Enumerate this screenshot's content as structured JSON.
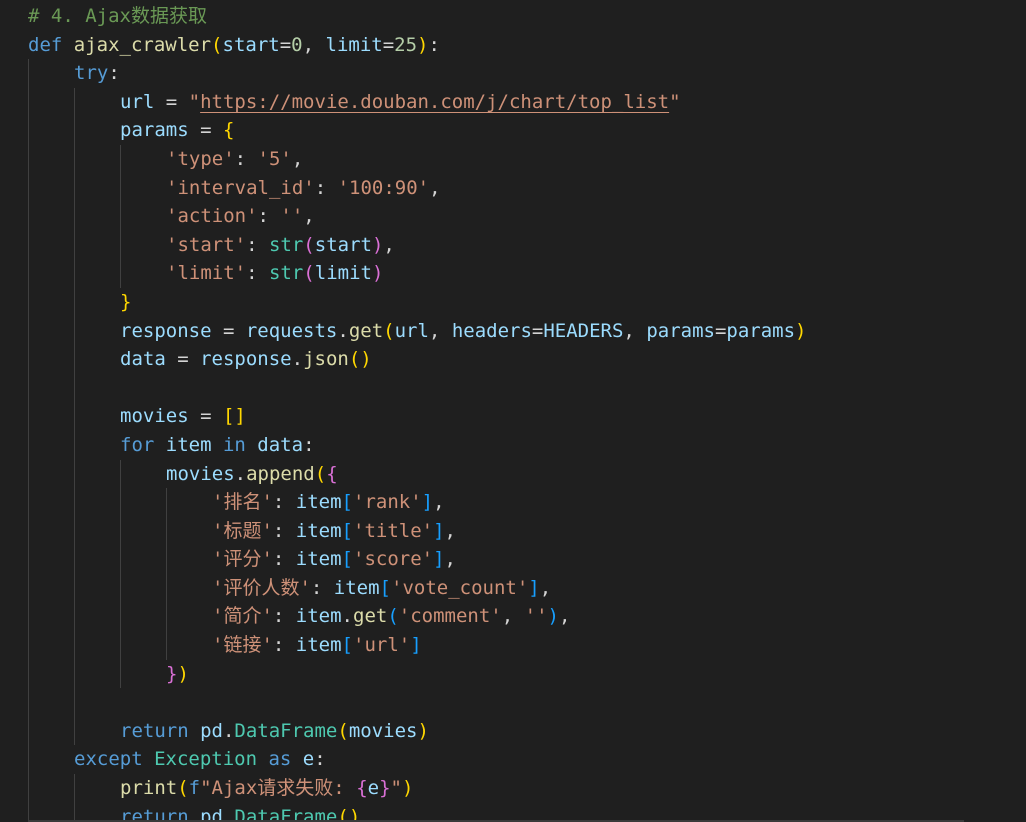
{
  "colors": {
    "background": "#1f1f1f",
    "comment": "#6a9955",
    "keyword": "#569cd6",
    "control": "#569cd6",
    "function": "#dcdcaa",
    "string": "#ce9178",
    "number": "#b5cea8",
    "variable": "#9cdcfe",
    "plain": "#d4d4d4",
    "class": "#4ec9b0",
    "bracket1": "#ffd700",
    "bracket2": "#da70d6",
    "bracket3": "#179fff"
  },
  "code_lines": [
    {
      "indent": 0,
      "tokens": [
        {
          "t": "# 4. Ajax数据获取",
          "c": "comment"
        }
      ]
    },
    {
      "indent": 0,
      "tokens": [
        {
          "t": "def ",
          "c": "keyword"
        },
        {
          "t": "ajax_crawler",
          "c": "function"
        },
        {
          "t": "(",
          "c": "bracket1"
        },
        {
          "t": "start",
          "c": "variable"
        },
        {
          "t": "=",
          "c": "plain"
        },
        {
          "t": "0",
          "c": "number"
        },
        {
          "t": ", ",
          "c": "plain"
        },
        {
          "t": "limit",
          "c": "variable"
        },
        {
          "t": "=",
          "c": "plain"
        },
        {
          "t": "25",
          "c": "number"
        },
        {
          "t": ")",
          "c": "bracket1"
        },
        {
          "t": ":",
          "c": "plain"
        }
      ]
    },
    {
      "indent": 1,
      "tokens": [
        {
          "t": "try",
          "c": "control"
        },
        {
          "t": ":",
          "c": "plain"
        }
      ]
    },
    {
      "indent": 2,
      "tokens": [
        {
          "t": "url",
          "c": "variable"
        },
        {
          "t": " = ",
          "c": "plain"
        },
        {
          "t": "\"",
          "c": "string"
        },
        {
          "t": "https://movie.douban.com/j/chart/top_list",
          "c": "string",
          "u": true
        },
        {
          "t": "\"",
          "c": "string"
        }
      ]
    },
    {
      "indent": 2,
      "tokens": [
        {
          "t": "params",
          "c": "variable"
        },
        {
          "t": " = ",
          "c": "plain"
        },
        {
          "t": "{",
          "c": "bracket1"
        }
      ]
    },
    {
      "indent": 3,
      "tokens": [
        {
          "t": "'type'",
          "c": "string"
        },
        {
          "t": ": ",
          "c": "plain"
        },
        {
          "t": "'5'",
          "c": "string"
        },
        {
          "t": ",",
          "c": "plain"
        }
      ]
    },
    {
      "indent": 3,
      "tokens": [
        {
          "t": "'interval_id'",
          "c": "string"
        },
        {
          "t": ": ",
          "c": "plain"
        },
        {
          "t": "'100:90'",
          "c": "string"
        },
        {
          "t": ",",
          "c": "plain"
        }
      ]
    },
    {
      "indent": 3,
      "tokens": [
        {
          "t": "'action'",
          "c": "string"
        },
        {
          "t": ": ",
          "c": "plain"
        },
        {
          "t": "''",
          "c": "string"
        },
        {
          "t": ",",
          "c": "plain"
        }
      ]
    },
    {
      "indent": 3,
      "tokens": [
        {
          "t": "'start'",
          "c": "string"
        },
        {
          "t": ": ",
          "c": "plain"
        },
        {
          "t": "str",
          "c": "class"
        },
        {
          "t": "(",
          "c": "bracket2"
        },
        {
          "t": "start",
          "c": "variable"
        },
        {
          "t": ")",
          "c": "bracket2"
        },
        {
          "t": ",",
          "c": "plain"
        }
      ]
    },
    {
      "indent": 3,
      "tokens": [
        {
          "t": "'limit'",
          "c": "string"
        },
        {
          "t": ": ",
          "c": "plain"
        },
        {
          "t": "str",
          "c": "class"
        },
        {
          "t": "(",
          "c": "bracket2"
        },
        {
          "t": "limit",
          "c": "variable"
        },
        {
          "t": ")",
          "c": "bracket2"
        }
      ]
    },
    {
      "indent": 2,
      "tokens": [
        {
          "t": "}",
          "c": "bracket1"
        }
      ]
    },
    {
      "indent": 2,
      "tokens": [
        {
          "t": "response",
          "c": "variable"
        },
        {
          "t": " = ",
          "c": "plain"
        },
        {
          "t": "requests",
          "c": "variable"
        },
        {
          "t": ".",
          "c": "plain"
        },
        {
          "t": "get",
          "c": "function"
        },
        {
          "t": "(",
          "c": "bracket1"
        },
        {
          "t": "url",
          "c": "variable"
        },
        {
          "t": ", ",
          "c": "plain"
        },
        {
          "t": "headers",
          "c": "variable"
        },
        {
          "t": "=",
          "c": "plain"
        },
        {
          "t": "HEADERS",
          "c": "variable"
        },
        {
          "t": ", ",
          "c": "plain"
        },
        {
          "t": "params",
          "c": "variable"
        },
        {
          "t": "=",
          "c": "plain"
        },
        {
          "t": "params",
          "c": "variable"
        },
        {
          "t": ")",
          "c": "bracket1"
        }
      ]
    },
    {
      "indent": 2,
      "tokens": [
        {
          "t": "data",
          "c": "variable"
        },
        {
          "t": " = ",
          "c": "plain"
        },
        {
          "t": "response",
          "c": "variable"
        },
        {
          "t": ".",
          "c": "plain"
        },
        {
          "t": "json",
          "c": "function"
        },
        {
          "t": "()",
          "c": "bracket1"
        }
      ]
    },
    {
      "indent": 2,
      "tokens": []
    },
    {
      "indent": 2,
      "tokens": [
        {
          "t": "movies",
          "c": "variable"
        },
        {
          "t": " = ",
          "c": "plain"
        },
        {
          "t": "[]",
          "c": "bracket1"
        }
      ]
    },
    {
      "indent": 2,
      "tokens": [
        {
          "t": "for ",
          "c": "control"
        },
        {
          "t": "item",
          "c": "variable"
        },
        {
          "t": " in ",
          "c": "keyword"
        },
        {
          "t": "data",
          "c": "variable"
        },
        {
          "t": ":",
          "c": "plain"
        }
      ]
    },
    {
      "indent": 3,
      "tokens": [
        {
          "t": "movies",
          "c": "variable"
        },
        {
          "t": ".",
          "c": "plain"
        },
        {
          "t": "append",
          "c": "function"
        },
        {
          "t": "(",
          "c": "bracket1"
        },
        {
          "t": "{",
          "c": "bracket2"
        }
      ]
    },
    {
      "indent": 4,
      "tokens": [
        {
          "t": "'排名'",
          "c": "string"
        },
        {
          "t": ": ",
          "c": "plain"
        },
        {
          "t": "item",
          "c": "variable"
        },
        {
          "t": "[",
          "c": "bracket3"
        },
        {
          "t": "'rank'",
          "c": "string"
        },
        {
          "t": "]",
          "c": "bracket3"
        },
        {
          "t": ",",
          "c": "plain"
        }
      ]
    },
    {
      "indent": 4,
      "tokens": [
        {
          "t": "'标题'",
          "c": "string"
        },
        {
          "t": ": ",
          "c": "plain"
        },
        {
          "t": "item",
          "c": "variable"
        },
        {
          "t": "[",
          "c": "bracket3"
        },
        {
          "t": "'title'",
          "c": "string"
        },
        {
          "t": "]",
          "c": "bracket3"
        },
        {
          "t": ",",
          "c": "plain"
        }
      ]
    },
    {
      "indent": 4,
      "tokens": [
        {
          "t": "'评分'",
          "c": "string"
        },
        {
          "t": ": ",
          "c": "plain"
        },
        {
          "t": "item",
          "c": "variable"
        },
        {
          "t": "[",
          "c": "bracket3"
        },
        {
          "t": "'score'",
          "c": "string"
        },
        {
          "t": "]",
          "c": "bracket3"
        },
        {
          "t": ",",
          "c": "plain"
        }
      ]
    },
    {
      "indent": 4,
      "tokens": [
        {
          "t": "'评价人数'",
          "c": "string"
        },
        {
          "t": ": ",
          "c": "plain"
        },
        {
          "t": "item",
          "c": "variable"
        },
        {
          "t": "[",
          "c": "bracket3"
        },
        {
          "t": "'vote_count'",
          "c": "string"
        },
        {
          "t": "]",
          "c": "bracket3"
        },
        {
          "t": ",",
          "c": "plain"
        }
      ]
    },
    {
      "indent": 4,
      "tokens": [
        {
          "t": "'简介'",
          "c": "string"
        },
        {
          "t": ": ",
          "c": "plain"
        },
        {
          "t": "item",
          "c": "variable"
        },
        {
          "t": ".",
          "c": "plain"
        },
        {
          "t": "get",
          "c": "function"
        },
        {
          "t": "(",
          "c": "bracket3"
        },
        {
          "t": "'comment'",
          "c": "string"
        },
        {
          "t": ", ",
          "c": "plain"
        },
        {
          "t": "''",
          "c": "string"
        },
        {
          "t": ")",
          "c": "bracket3"
        },
        {
          "t": ",",
          "c": "plain"
        }
      ]
    },
    {
      "indent": 4,
      "tokens": [
        {
          "t": "'链接'",
          "c": "string"
        },
        {
          "t": ": ",
          "c": "plain"
        },
        {
          "t": "item",
          "c": "variable"
        },
        {
          "t": "[",
          "c": "bracket3"
        },
        {
          "t": "'url'",
          "c": "string"
        },
        {
          "t": "]",
          "c": "bracket3"
        }
      ]
    },
    {
      "indent": 3,
      "tokens": [
        {
          "t": "}",
          "c": "bracket2"
        },
        {
          "t": ")",
          "c": "bracket1"
        }
      ]
    },
    {
      "indent": 2,
      "tokens": []
    },
    {
      "indent": 2,
      "tokens": [
        {
          "t": "return ",
          "c": "control"
        },
        {
          "t": "pd",
          "c": "variable"
        },
        {
          "t": ".",
          "c": "plain"
        },
        {
          "t": "DataFrame",
          "c": "class"
        },
        {
          "t": "(",
          "c": "bracket1"
        },
        {
          "t": "movies",
          "c": "variable"
        },
        {
          "t": ")",
          "c": "bracket1"
        }
      ]
    },
    {
      "indent": 1,
      "tokens": [
        {
          "t": "except ",
          "c": "control"
        },
        {
          "t": "Exception",
          "c": "class"
        },
        {
          "t": " as ",
          "c": "keyword"
        },
        {
          "t": "e",
          "c": "variable"
        },
        {
          "t": ":",
          "c": "plain"
        }
      ]
    },
    {
      "indent": 2,
      "tokens": [
        {
          "t": "print",
          "c": "function"
        },
        {
          "t": "(",
          "c": "bracket1"
        },
        {
          "t": "f",
          "c": "keyword"
        },
        {
          "t": "\"Ajax请求失败: ",
          "c": "string"
        },
        {
          "t": "{",
          "c": "bracket2"
        },
        {
          "t": "e",
          "c": "variable"
        },
        {
          "t": "}",
          "c": "bracket2"
        },
        {
          "t": "\"",
          "c": "string"
        },
        {
          "t": ")",
          "c": "bracket1"
        }
      ]
    },
    {
      "indent": 2,
      "tokens": [
        {
          "t": "return ",
          "c": "control"
        },
        {
          "t": "pd",
          "c": "variable"
        },
        {
          "t": ".",
          "c": "plain"
        },
        {
          "t": "DataFrame",
          "c": "class"
        },
        {
          "t": "()",
          "c": "bracket1"
        }
      ]
    }
  ]
}
